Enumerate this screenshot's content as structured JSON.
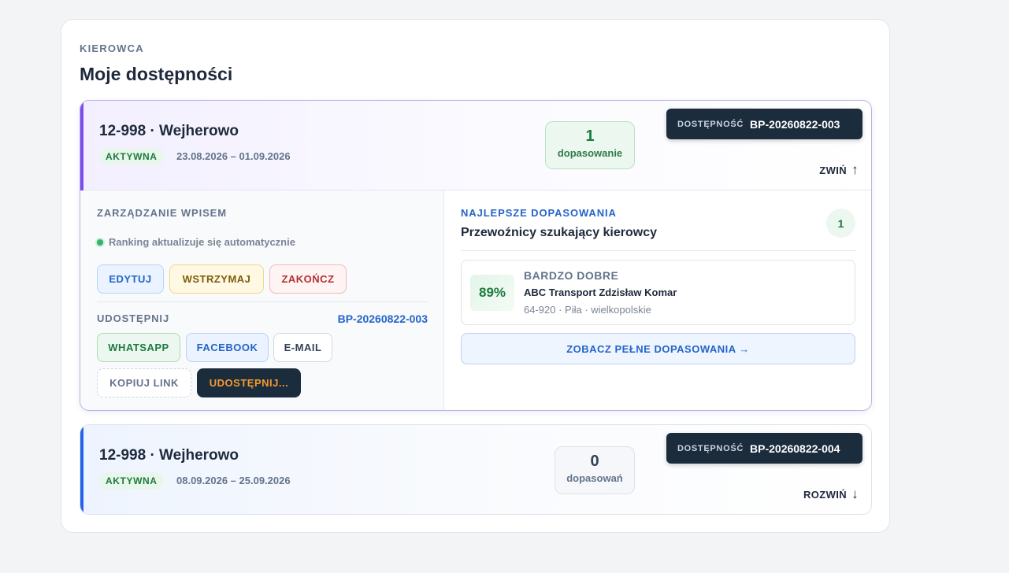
{
  "header": {
    "eyebrow": "KIEROWCA",
    "title": "Moje dostępności"
  },
  "availability_badge_label": "DOSTĘPNOŚĆ",
  "cards": [
    {
      "route": "12-998 · Wejherowo",
      "status": "AKTYWNA",
      "dates": "23.08.2026 – 01.09.2026",
      "match_count": "1",
      "match_label": "dopasowanie",
      "id": "BP-20260822-003",
      "toggle_label": "ZWIŃ",
      "toggle_icon": "↑",
      "expanded": true,
      "management": {
        "title": "ZARZĄDZANIE WPISEM",
        "auto_ranking": "Ranking aktualizuje się automatycznie",
        "edit": "EDYTUJ",
        "pause": "WSTRZYMAJ",
        "end": "ZAKOŃCZ"
      },
      "share": {
        "title": "UDOSTĘPNIJ",
        "id": "BP-20260822-003",
        "whatsapp": "WHATSAPP",
        "facebook": "FACEBOOK",
        "email": "E-MAIL",
        "copy_link": "KOPIUJ LINK",
        "share_more": "UDOSTĘPNIJ..."
      },
      "best_matches": {
        "eyebrow": "NAJLEPSZE DOPASOWANIA",
        "title": "Przewoźnicy szukający kierowcy",
        "count": "1",
        "items": [
          {
            "percent": "89%",
            "quality": "BARDZO DOBRE",
            "name": "ABC Transport Zdzisław Komar",
            "location": "64-920 · Piła · wielkopolskie"
          }
        ],
        "see_all": "ZOBACZ PEŁNE DOPASOWANIA →"
      }
    },
    {
      "route": "12-998 · Wejherowo",
      "status": "AKTYWNA",
      "dates": "08.09.2026 – 25.09.2026",
      "match_count": "0",
      "match_label": "dopasowań",
      "id": "BP-20260822-004",
      "toggle_label": "ROZWIŃ",
      "toggle_icon": "↓",
      "expanded": false
    }
  ],
  "colors": {
    "accent_purple": "#7c4dea",
    "accent_blue": "#2563eb",
    "dark_navy": "#1b2c3d",
    "success_green": "#1c7a3e",
    "link_blue": "#2464c9",
    "share_orange": "#f59a30"
  }
}
